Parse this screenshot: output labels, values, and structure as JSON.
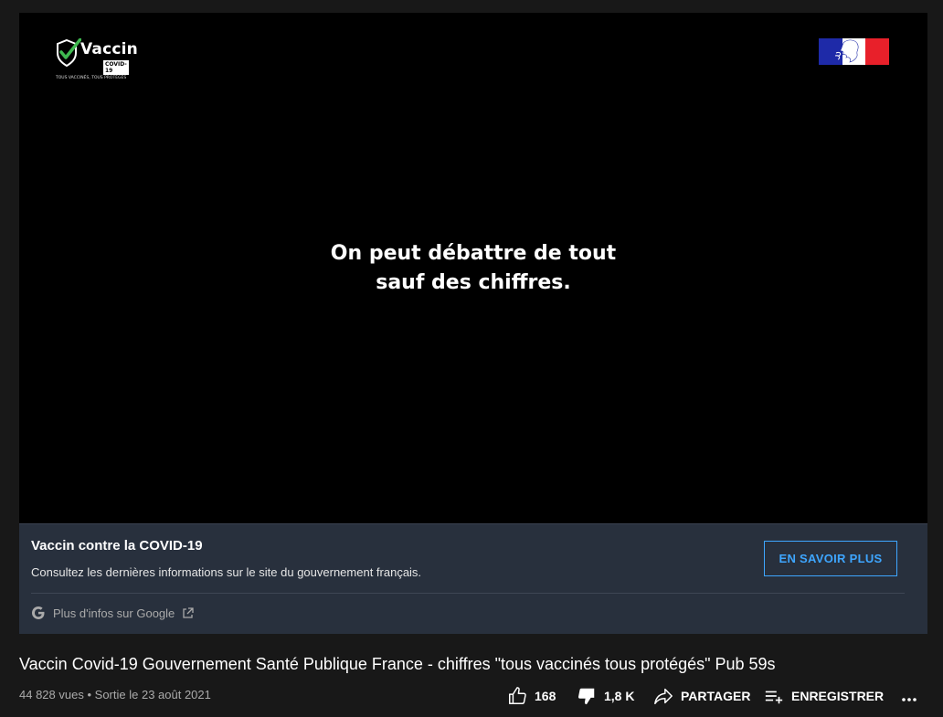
{
  "video": {
    "overlay_line1": "On peut débattre de tout",
    "overlay_line2": "sauf des chiffres.",
    "logo_word": "Vaccin",
    "logo_sub": "COVID-19",
    "logo_tagline": "TOUS VACCINÉS, TOUS PROTÉGÉS"
  },
  "info_panel": {
    "title": "Vaccin contre la COVID-19",
    "description": "Consultez les dernières informations sur le site du gouvernement français.",
    "button_label": "EN SAVOIR PLUS",
    "google_link": "Plus d'infos sur Google"
  },
  "title": "Vaccin Covid-19 Gouvernement Santé Publique France - chiffres \"tous vaccinés tous protégés\" Pub 59s",
  "meta": {
    "views": "44 828 vues",
    "separator": "•",
    "date": "Sortie le 23 août 2021"
  },
  "actions": {
    "likes": "168",
    "dislikes": "1,8 K",
    "share": "PARTAGER",
    "save": "ENREGISTRER"
  },
  "colors": {
    "accent": "#3ea6ff",
    "panel": "#28303d",
    "background": "#181818",
    "logo_green": "#3fb950"
  }
}
